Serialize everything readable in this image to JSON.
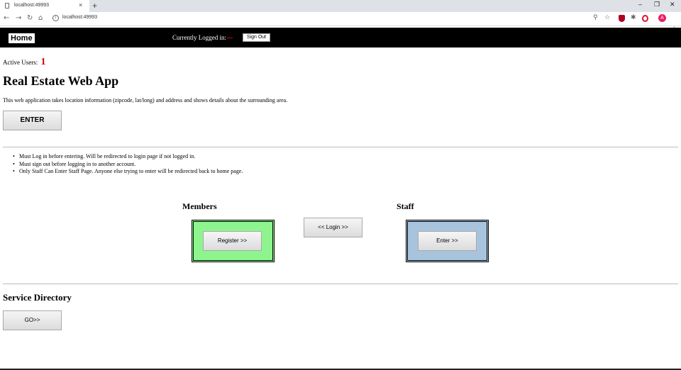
{
  "browser": {
    "tab_title": "localhost:49993",
    "tab_close": "×",
    "new_tab": "+",
    "url": "localhost:49993",
    "window_minimize": "–",
    "window_restore": "❐",
    "window_close": "✕",
    "nav_back": "←",
    "nav_forward": "→",
    "nav_reload": "↻",
    "nav_home": "⌂",
    "zoom_icon": "⚲",
    "bookmark_star": "☆",
    "puzzle_icon": "✱",
    "avatar_letter": "A",
    "menu_dots": "⋮",
    "info_icon": "i"
  },
  "nav": {
    "home_label": "Home",
    "logged_in_label": "Currently Logged in:",
    "sign_out_label": "Sign Out"
  },
  "main": {
    "active_users_label": "Active Users:",
    "active_users_count": "1",
    "title": "Real Estate Web App",
    "description": "This web application takes location information (zipcode, lat/long) and address and shows details about the surrounding area.",
    "enter_label": "ENTER",
    "rules": [
      "Must Log in before entering. Will be redirected to login page if not logged in.",
      "Must sign out before logging in to another account.",
      "Only Staff Can Enter Staff Page. Anyone else trying to enter will be redirected back to home page."
    ],
    "members_heading": "Members",
    "register_label": "Register >>",
    "login_label": "<< Login >>",
    "staff_heading": "Staff",
    "staff_enter_label": "Enter >>",
    "service_heading": "Service Directory",
    "go_label": "GO>>"
  },
  "colors": {
    "members_box": "#8ef58e",
    "staff_box": "#a8c4dc",
    "nav_bar": "#000000",
    "active_count": "#cc0000"
  }
}
